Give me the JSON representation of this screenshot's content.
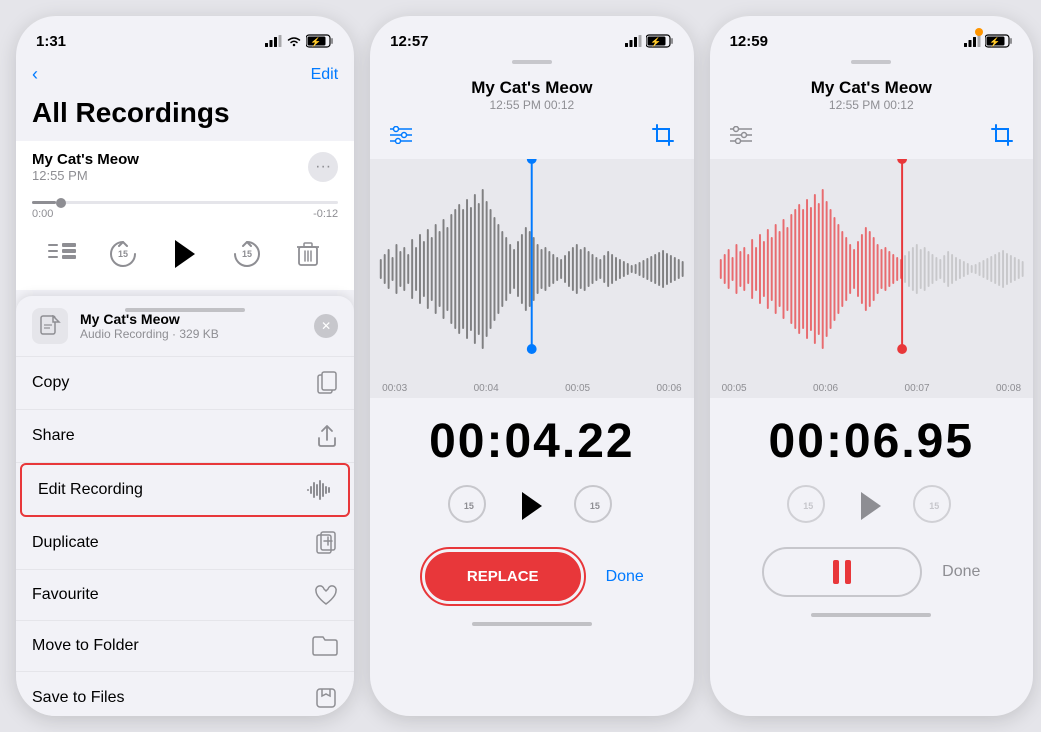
{
  "panel1": {
    "status_time": "1:31",
    "nav_back": "<",
    "nav_edit": "Edit",
    "title": "All Recordings",
    "recording_name": "My Cat's Meow",
    "recording_time": "12:55 PM",
    "progress_start": "0:00",
    "progress_end": "-0:12",
    "context_menu": {
      "filename": "My Cat's Meow",
      "file_type": "Audio Recording · 329 KB",
      "items": [
        {
          "label": "Copy",
          "icon": "copy"
        },
        {
          "label": "Share",
          "icon": "share"
        },
        {
          "label": "Edit Recording",
          "icon": "waveform",
          "highlighted": true
        },
        {
          "label": "Duplicate",
          "icon": "duplicate"
        },
        {
          "label": "Favourite",
          "icon": "heart"
        },
        {
          "label": "Move to Folder",
          "icon": "folder"
        },
        {
          "label": "Save to Files",
          "icon": "files"
        }
      ]
    }
  },
  "panel2": {
    "status_time": "12:57",
    "title": "My Cat's Meow",
    "subtitle": "12:55 PM  00:12",
    "big_time": "00:04.22",
    "time_labels": [
      "00:03",
      "00:04",
      "00:05",
      "00:06"
    ],
    "replace_btn": "REPLACE",
    "done_btn": "Done"
  },
  "panel3": {
    "status_time": "12:59",
    "title": "My Cat's Meow",
    "subtitle": "12:55 PM  00:12",
    "big_time": "00:06.95",
    "time_labels": [
      "00:05",
      "00:06",
      "00:07",
      "00:08"
    ],
    "done_btn": "Done"
  }
}
